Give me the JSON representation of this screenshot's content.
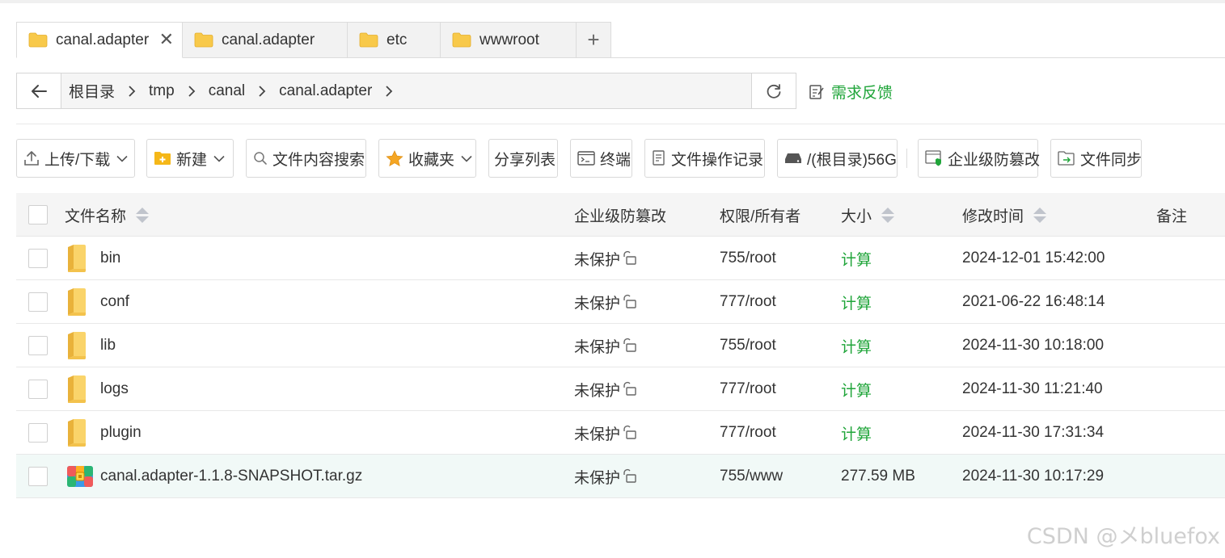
{
  "tabs": [
    {
      "label": "canal.adapter",
      "active": true,
      "closable": true
    },
    {
      "label": "canal.adapter",
      "active": false
    },
    {
      "label": "etc",
      "active": false
    },
    {
      "label": "wwwroot",
      "active": false
    }
  ],
  "tab_add_label": "+",
  "tab_close_label": "✕",
  "breadcrumb": [
    "根目录",
    "tmp",
    "canal",
    "canal.adapter"
  ],
  "feedback_label": "需求反馈",
  "toolbar": {
    "upload": "上传/下载",
    "new": "新建",
    "search": "文件内容搜索",
    "favorites": "收藏夹",
    "share_list": "分享列表",
    "terminal": "终端",
    "op_log": "文件操作记录",
    "disk": "/(根目录)56G",
    "tamper": "企业级防篡改",
    "sync": "文件同步"
  },
  "columns": {
    "name": "文件名称",
    "tamper": "企业级防篡改",
    "perm": "权限/所有者",
    "size": "大小",
    "mtime": "修改时间",
    "note": "备注"
  },
  "rows": [
    {
      "name": "bin",
      "type": "folder",
      "tamper": "未保护",
      "perm": "755/root",
      "size": "计算",
      "mtime": "2024-12-01 15:42:00"
    },
    {
      "name": "conf",
      "type": "folder",
      "tamper": "未保护",
      "perm": "777/root",
      "size": "计算",
      "mtime": "2021-06-22 16:48:14"
    },
    {
      "name": "lib",
      "type": "folder",
      "tamper": "未保护",
      "perm": "755/root",
      "size": "计算",
      "mtime": "2024-11-30 10:18:00"
    },
    {
      "name": "logs",
      "type": "folder",
      "tamper": "未保护",
      "perm": "777/root",
      "size": "计算",
      "mtime": "2024-11-30 11:21:40"
    },
    {
      "name": "plugin",
      "type": "folder",
      "tamper": "未保护",
      "perm": "777/root",
      "size": "计算",
      "mtime": "2024-11-30 17:31:34"
    },
    {
      "name": "canal.adapter-1.1.8-SNAPSHOT.tar.gz",
      "type": "archive",
      "tamper": "未保护",
      "perm": "755/www",
      "size": "277.59 MB",
      "mtime": "2024-11-30 10:17:29"
    }
  ],
  "watermark": "CSDN @メbluefox",
  "colors": {
    "accent": "#20a53a",
    "folder": "#f8c94a",
    "highlight_row": "#f1f9f7"
  }
}
